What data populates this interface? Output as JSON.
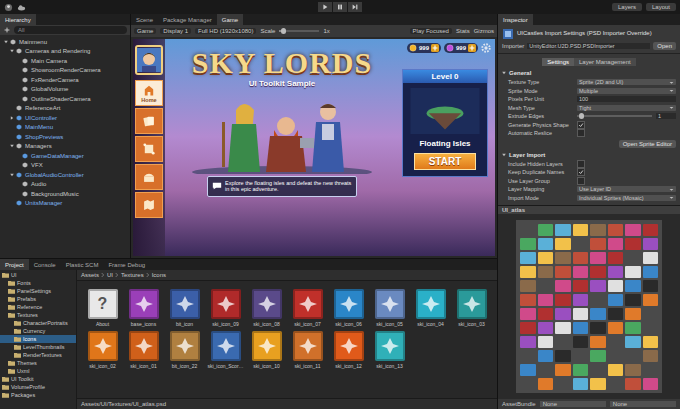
{
  "toolbar": {
    "layers": "Layers",
    "layout": "Layout",
    "playing": false
  },
  "hierarchy": {
    "title": "Hierarchy",
    "search_placeholder": "All",
    "items": [
      {
        "label": "Mainmenu",
        "depth": 0,
        "kind": "group",
        "expanded": true,
        "prefab": false,
        "selected": false
      },
      {
        "label": "Cameras and Rendering",
        "depth": 1,
        "kind": "group",
        "expanded": true,
        "prefab": false,
        "selected": false
      },
      {
        "label": "Main Camera",
        "depth": 2,
        "kind": "object",
        "expanded": false,
        "prefab": false,
        "selected": false
      },
      {
        "label": "ShowroomRenderCamera",
        "depth": 2,
        "kind": "object",
        "expanded": false,
        "prefab": false,
        "selected": false
      },
      {
        "label": "FxRenderCamera",
        "depth": 2,
        "kind": "object",
        "expanded": false,
        "prefab": false,
        "selected": false
      },
      {
        "label": "GlobalVolume",
        "depth": 2,
        "kind": "object",
        "expanded": false,
        "prefab": false,
        "selected": false
      },
      {
        "label": "OutlineShaderCamera",
        "depth": 2,
        "kind": "object",
        "expanded": false,
        "prefab": false,
        "selected": false
      },
      {
        "label": "ReferenceArt",
        "depth": 1,
        "kind": "object",
        "expanded": false,
        "prefab": false,
        "selected": false
      },
      {
        "label": "UIController",
        "depth": 1,
        "kind": "group",
        "expanded": false,
        "prefab": true,
        "selected": false
      },
      {
        "label": "MainMenu",
        "depth": 1,
        "kind": "object",
        "expanded": false,
        "prefab": true,
        "selected": false
      },
      {
        "label": "ShopPreviews",
        "depth": 1,
        "kind": "object",
        "expanded": false,
        "prefab": true,
        "selected": false
      },
      {
        "label": "Managers",
        "depth": 1,
        "kind": "group",
        "expanded": true,
        "prefab": false,
        "selected": false
      },
      {
        "label": "GameDataManager",
        "depth": 2,
        "kind": "object",
        "expanded": false,
        "prefab": true,
        "selected": false
      },
      {
        "label": "VFX",
        "depth": 2,
        "kind": "object",
        "expanded": false,
        "prefab": false,
        "selected": false
      },
      {
        "label": "GlobalAudioController",
        "depth": 1,
        "kind": "group",
        "expanded": true,
        "prefab": true,
        "selected": false
      },
      {
        "label": "Audio",
        "depth": 2,
        "kind": "object",
        "expanded": false,
        "prefab": false,
        "selected": false
      },
      {
        "label": "BackgroundMusic",
        "depth": 2,
        "kind": "object",
        "expanded": false,
        "prefab": false,
        "selected": false
      },
      {
        "label": "UnitsManager",
        "depth": 1,
        "kind": "object",
        "expanded": false,
        "prefab": true,
        "selected": false
      }
    ]
  },
  "view_tabs": [
    {
      "label": "Scene",
      "selected": false
    },
    {
      "label": "Package Manager",
      "selected": false
    },
    {
      "label": "Game",
      "selected": true
    }
  ],
  "game_toolbar": {
    "mode": "Game",
    "display": "Display 1",
    "resolution": "Full HD (1920x1080)",
    "scale_label": "Scale",
    "scale_level": 0.05,
    "scale_value": "1x",
    "play_mode": "Play Focused",
    "stats": "Stats",
    "gizmos": "Gizmos"
  },
  "game": {
    "title": "SKY LORDS",
    "subtitle": "UI Toolkit Sample",
    "nav": [
      {
        "label": "Home",
        "kind": "home",
        "selected": true
      },
      {
        "kind": "cards",
        "selected": false
      },
      {
        "kind": "scroll",
        "selected": false
      },
      {
        "kind": "chest",
        "selected": false
      },
      {
        "kind": "map",
        "selected": false
      }
    ],
    "currencies": [
      {
        "amount": "999",
        "color": "#f2b52a"
      },
      {
        "amount": "999",
        "color": "#c04fe0"
      }
    ],
    "level_card": {
      "header": "Level 0",
      "name": "Floating Isles",
      "button": "START"
    },
    "description": "Explore the floating isles and defeat the new threats in this epic adventure."
  },
  "inspector": {
    "tab": "Inspector",
    "title": "UICastles Import Settings (PSD Importer Override)",
    "importer_label": "Importer",
    "importer_value": "UnityEditor.U2D.PSD.PSDImporter",
    "open_button": "Open",
    "tabs": [
      {
        "label": "Settings",
        "selected": true
      },
      {
        "label": "Layer Management",
        "selected": false
      }
    ],
    "general_title": "General",
    "general": [
      {
        "label": "Texture Type",
        "kind": "dropdown",
        "value": "Sprite (2D and UI)"
      },
      {
        "label": "Sprite Mode",
        "kind": "dropdown",
        "value": "Multiple"
      },
      {
        "label": "Pixels Per Unit",
        "kind": "text",
        "value": "100"
      },
      {
        "label": "Mesh Type",
        "kind": "dropdown",
        "value": "Tight"
      },
      {
        "label": "Extrude Edges",
        "kind": "slider",
        "value": "1",
        "level": 0.03
      },
      {
        "label": "Generate Physics Shape",
        "kind": "checkbox",
        "checked": true
      },
      {
        "label": "Automatic Reslice",
        "kind": "checkbox",
        "checked": false
      }
    ],
    "sprite_editor_button": "Open Sprite Editor",
    "layer_title": "Layer Import",
    "layer_import": [
      {
        "label": "Include Hidden Layers",
        "kind": "checkbox",
        "checked": false
      },
      {
        "label": "Keep Duplicate Names",
        "kind": "checkbox",
        "checked": true
      },
      {
        "label": "Use Layer Group",
        "kind": "checkbox",
        "checked": false
      },
      {
        "label": "Layer Mapping",
        "kind": "dropdown",
        "value": "Use Layer ID"
      },
      {
        "label": "Import Mode",
        "kind": "dropdown",
        "value": "Individual Sprites (Mosaic)"
      }
    ],
    "preview_title": "UI_atlas",
    "asset_bundle_label": "AssetBundle",
    "asset_bundle_value": "None",
    "asset_variant_value": "None"
  },
  "project": {
    "tabs": [
      {
        "label": "Project",
        "selected": true
      },
      {
        "label": "Console",
        "selected": false
      },
      {
        "label": "Plastic SCM",
        "selected": false
      },
      {
        "label": "Frame Debug",
        "selected": false
      }
    ],
    "tree": [
      {
        "label": "UI",
        "depth": 0,
        "selected": false
      },
      {
        "label": "Fonts",
        "depth": 1,
        "selected": false
      },
      {
        "label": "PanelSettings",
        "depth": 1,
        "selected": false
      },
      {
        "label": "Prefabs",
        "depth": 1,
        "selected": false
      },
      {
        "label": "Reference",
        "depth": 1,
        "selected": false
      },
      {
        "label": "Textures",
        "depth": 1,
        "selected": false
      },
      {
        "label": "CharacterPortraits",
        "depth": 2,
        "selected": false
      },
      {
        "label": "Currency",
        "depth": 2,
        "selected": false
      },
      {
        "label": "Icons",
        "depth": 2,
        "selected": true
      },
      {
        "label": "LevelThumbnails",
        "depth": 2,
        "selected": false
      },
      {
        "label": "RenderTextures",
        "depth": 2,
        "selected": false
      },
      {
        "label": "Themes",
        "depth": 1,
        "selected": false
      },
      {
        "label": "Uxml",
        "depth": 1,
        "selected": false
      },
      {
        "label": "UI Toolkit",
        "depth": 0,
        "selected": false
      },
      {
        "label": "VolumeProfile",
        "depth": 0,
        "selected": false
      },
      {
        "label": "Packages",
        "depth": 0,
        "selected": false
      }
    ],
    "breadcrumb": [
      "Assets",
      "UI",
      "Textures",
      "Icons"
    ],
    "assets": [
      {
        "label": "About",
        "color": "#e8e8e8",
        "glyph": "?"
      },
      {
        "label": "base_icons",
        "color": "#9a3fb8"
      },
      {
        "label": "bit_icon",
        "color": "#3b5fa8"
      },
      {
        "label": "ski_icon_09",
        "color": "#b02a2a"
      },
      {
        "label": "ski_icon_08",
        "color": "#5a4a8a"
      },
      {
        "label": "ski_icon_07",
        "color": "#c0302a"
      },
      {
        "label": "ski_icon_06",
        "color": "#2a86c8"
      },
      {
        "label": "ski_icon_05",
        "color": "#6a8ac0"
      },
      {
        "label": "ski_icon_04",
        "color": "#2ab0c8"
      },
      {
        "label": "ski_icon_03",
        "color": "#2a9a9a"
      },
      {
        "label": "ski_icon_02",
        "color": "#e0761a"
      },
      {
        "label": "ski_icon_01",
        "color": "#d0601a"
      },
      {
        "label": "bit_icon_22",
        "color": "#b08040"
      },
      {
        "label": "ski_icon_Scor…",
        "color": "#3a6ab0"
      },
      {
        "label": "ski_icon_10",
        "color": "#e8a020"
      },
      {
        "label": "ski_icon_11",
        "color": "#d0702a"
      },
      {
        "label": "ski_icon_12",
        "color": "#e05a1a"
      },
      {
        "label": "ski_icon_13",
        "color": "#30b0b8"
      }
    ],
    "path": "Assets/UI/Textures/UI_atlas.psd"
  }
}
